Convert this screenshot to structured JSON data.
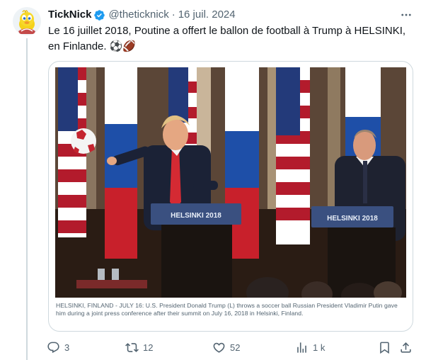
{
  "author": {
    "name": "TickNick",
    "handle": "@theticknick",
    "separator": "·",
    "date": "16 juil. 2024"
  },
  "post": {
    "text": "Le 16 juillet 2018, Poutine a offert le ballon de football à Trump à HELSINKI, en Finlande. ⚽🏈"
  },
  "media": {
    "podium_left_label": "HELSINKI 2018",
    "podium_right_label": "HELSINKI 2018",
    "caption": "HELSINKI, FINLAND - JULY 16: U.S. President Donald Trump (L) throws a soccer ball Russian President Vladimir Putin gave him during a joint press conference after their summit on July 16, 2018 in Helsinki, Finland."
  },
  "actions": {
    "replies": "3",
    "reposts": "12",
    "likes": "52",
    "views": "1 k"
  },
  "colors": {
    "accent": "#1d9bf0",
    "text_primary": "#0f1419",
    "text_secondary": "#536471",
    "border": "#cfd9de"
  },
  "icons": {
    "avatar": "tweety-bird-avatar",
    "verified": "verified-badge-icon",
    "more": "more-options-icon",
    "reply": "reply-icon",
    "repost": "repost-icon",
    "like": "heart-icon",
    "views": "views-chart-icon",
    "bookmark": "bookmark-icon",
    "share": "share-icon"
  }
}
